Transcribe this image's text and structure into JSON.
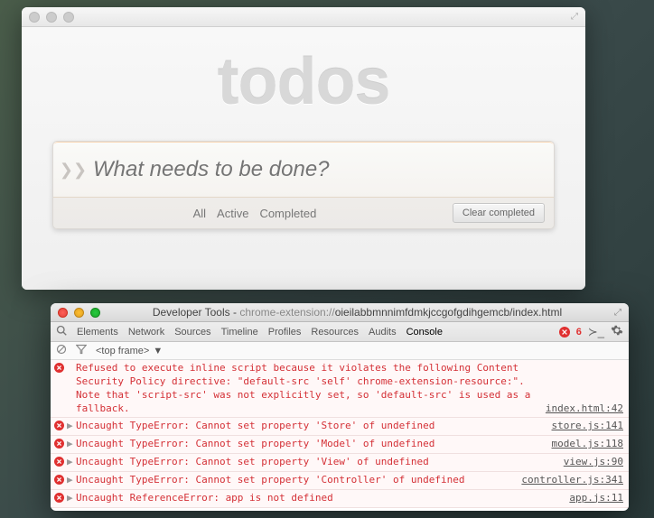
{
  "app": {
    "title": "todos",
    "input_placeholder": "What needs to be done?",
    "filters": {
      "all": "All",
      "active": "Active",
      "completed": "Completed"
    },
    "clear_completed": "Clear completed"
  },
  "devtools": {
    "window_title_prefix": "Developer Tools - ",
    "url_proto": "chrome-extension://",
    "url_rest": "oieilabbmnnimfdmkjccgofgdihgemcb/index.html",
    "tabs": [
      "Elements",
      "Network",
      "Sources",
      "Timeline",
      "Profiles",
      "Resources",
      "Audits",
      "Console"
    ],
    "active_tab": "Console",
    "error_count": "6",
    "frame_label": "<top frame>",
    "messages": [
      {
        "type": "error",
        "expandable": false,
        "text": "Refused to execute inline script because it violates the following Content Security Policy directive: \"default-src 'self' chrome-extension-resource:\". Note that 'script-src' was not explicitly set, so 'default-src' is used as a fallback.",
        "source": "index.html:42"
      },
      {
        "type": "error",
        "expandable": true,
        "text": "Uncaught TypeError: Cannot set property 'Store' of undefined",
        "source": "store.js:141"
      },
      {
        "type": "error",
        "expandable": true,
        "text": "Uncaught TypeError: Cannot set property 'Model' of undefined",
        "source": "model.js:118"
      },
      {
        "type": "error",
        "expandable": true,
        "text": "Uncaught TypeError: Cannot set property 'View' of undefined",
        "source": "view.js:90"
      },
      {
        "type": "error",
        "expandable": true,
        "text": "Uncaught TypeError: Cannot set property 'Controller' of undefined",
        "source": "controller.js:341"
      },
      {
        "type": "error",
        "expandable": true,
        "text": "Uncaught ReferenceError: app is not defined",
        "source": "app.js:11"
      }
    ]
  }
}
